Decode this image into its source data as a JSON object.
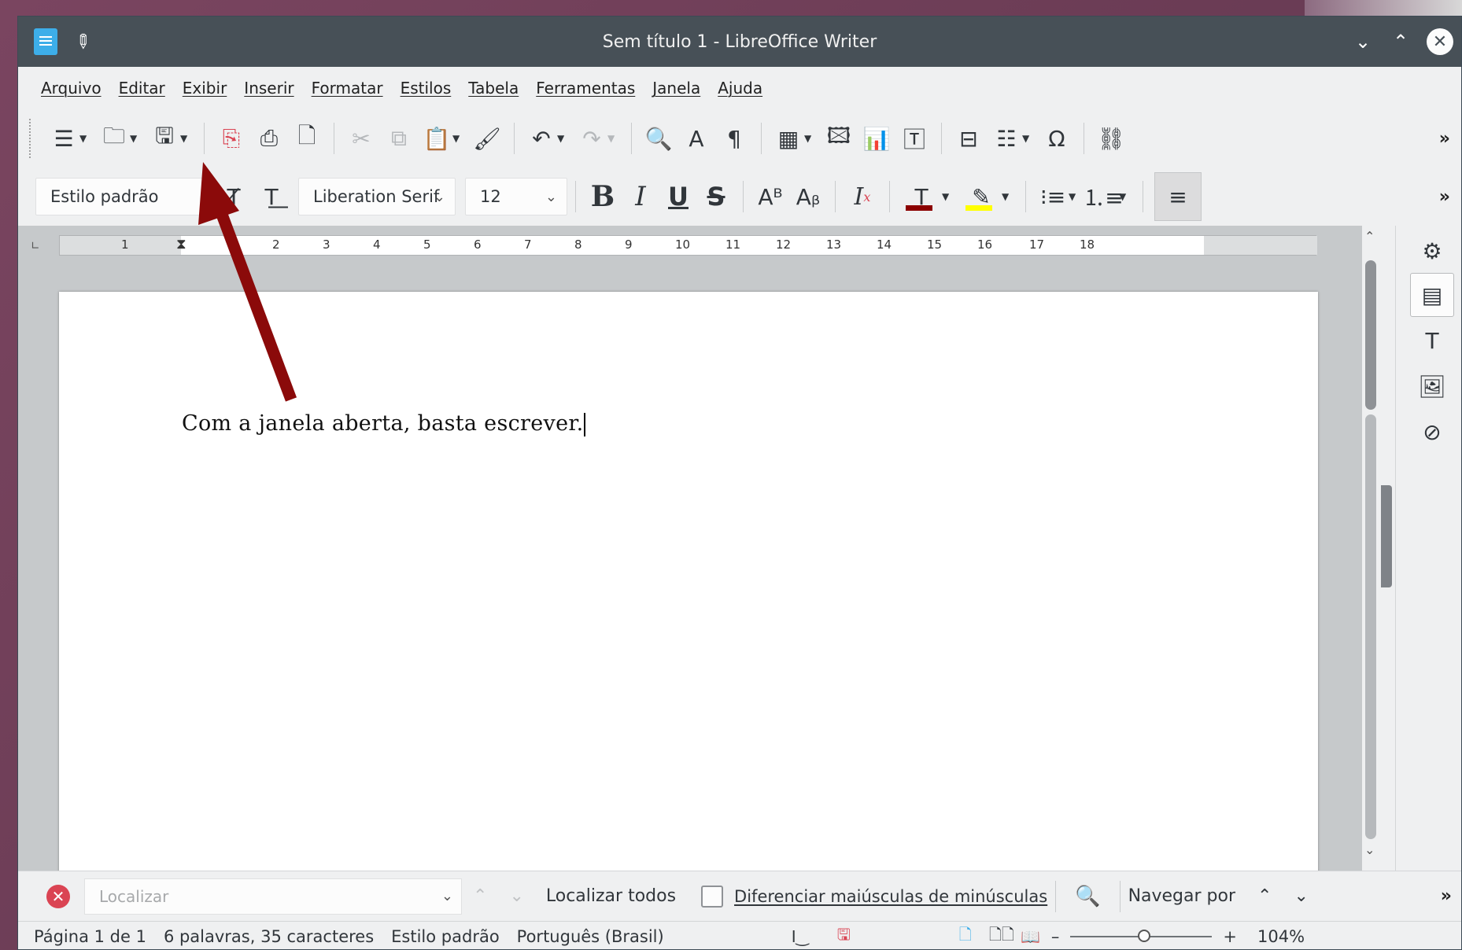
{
  "window": {
    "title": "Sem título 1 - LibreOffice Writer"
  },
  "menu": [
    "Arquivo",
    "Editar",
    "Exibir",
    "Inserir",
    "Formatar",
    "Estilos",
    "Tabela",
    "Ferramentas",
    "Janela",
    "Ajuda"
  ],
  "format_toolbar": {
    "paragraph_style": "Estilo padrão",
    "font_name": "Liberation Serif",
    "font_size": "12"
  },
  "ruler": {
    "numbers": [
      "1",
      "1",
      "2",
      "3",
      "4",
      "5",
      "6",
      "7",
      "8",
      "9",
      "10",
      "11",
      "12",
      "13",
      "14",
      "15",
      "16",
      "17",
      "18"
    ]
  },
  "document": {
    "text": "Com a janela aberta, basta escrever."
  },
  "findbar": {
    "placeholder": "Localizar",
    "find_all": "Localizar todos",
    "match_case": "Diferenciar maiúsculas de minúsculas",
    "navigate_by": "Navegar por"
  },
  "status": {
    "page": "Página 1 de 1",
    "words": "6 palavras, 35 caracteres",
    "style": "Estilo padrão",
    "language": "Português (Brasil)",
    "zoom": "104%",
    "zoom_minus": "–",
    "zoom_plus": "+"
  },
  "colors": {
    "font_color": "#8b0000",
    "highlight_color": "#ffff00",
    "arrow_color": "#8b0a0a"
  }
}
